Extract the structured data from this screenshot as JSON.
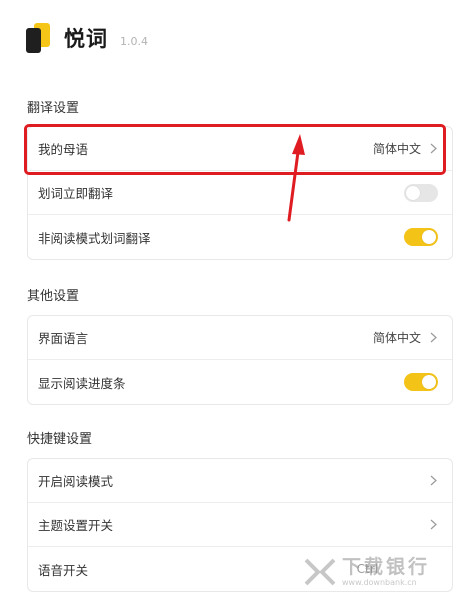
{
  "app": {
    "name": "悦词",
    "version": "1.0.4"
  },
  "sections": [
    {
      "title": "翻译设置",
      "rows": [
        {
          "label": "我的母语",
          "value": "简体中文"
        },
        {
          "label": "划词立即翻译",
          "toggle": false
        },
        {
          "label": "非阅读模式划词翻译",
          "toggle": true
        }
      ]
    },
    {
      "title": "其他设置",
      "rows": [
        {
          "label": "界面语言",
          "value": "简体中文"
        },
        {
          "label": "显示阅读进度条",
          "toggle": true
        }
      ]
    },
    {
      "title": "快捷键设置",
      "rows": [
        {
          "label": "开启阅读模式"
        },
        {
          "label": "主题设置开关"
        },
        {
          "label": "语音开关",
          "value": "Ctrl"
        }
      ]
    }
  ],
  "annotation": {
    "color": "#e01c23"
  },
  "watermark": {
    "text": "下载银行",
    "url": "www.downbank.cn"
  },
  "colors": {
    "toggle_on": "#f4c318",
    "toggle_off": "#e6e6e6",
    "logo_accent": "#f5c518"
  }
}
